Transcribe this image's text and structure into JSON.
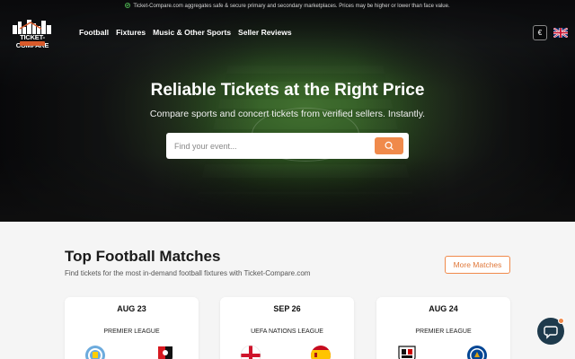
{
  "topbar": {
    "notice": "Ticket-Compare.com aggregates safe & secure primary and secondary marketplaces. Prices may be higher or lower than face value."
  },
  "logo": {
    "text": "TICKET-COMPARE"
  },
  "nav": {
    "items": [
      {
        "label": "Football"
      },
      {
        "label": "Fixtures"
      },
      {
        "label": "Music & Other Sports"
      },
      {
        "label": "Seller Reviews"
      }
    ]
  },
  "currency": {
    "symbol": "€"
  },
  "language": {
    "flag": "uk-flag-icon"
  },
  "hero": {
    "title": "Reliable Tickets at the Right Price",
    "subtitle": "Compare sports and concert tickets from verified sellers. Instantly."
  },
  "search": {
    "placeholder": "Find your event...",
    "icon": "search-icon"
  },
  "matches": {
    "title": "Top Football Matches",
    "subtitle": "Find tickets for the most in-demand football fixtures with Ticket-Compare.com",
    "more_label": "More Matches",
    "cards": [
      {
        "date": "AUG 23",
        "league": "PREMIER LEAGUE",
        "home": "man-city-crest",
        "away": "bournemouth-crest"
      },
      {
        "date": "SEP 26",
        "league": "UEFA NATIONS LEAGUE",
        "home": "england-flag",
        "away": "spain-flag"
      },
      {
        "date": "AUG 24",
        "league": "PREMIER LEAGUE",
        "home": "fulham-crest",
        "away": "chelsea-crest"
      }
    ]
  },
  "colors": {
    "accent": "#f08a4b",
    "dark": "#1e3a4c"
  },
  "chat": {
    "icon": "chat-bubble-icon"
  }
}
